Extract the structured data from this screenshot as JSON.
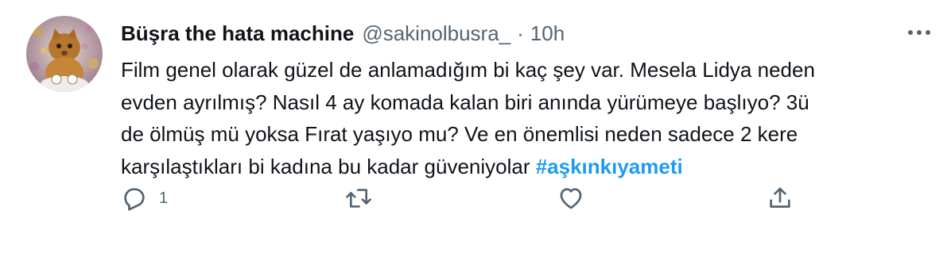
{
  "tweet": {
    "author_name": "Büşra the hata machine",
    "handle": "@sakinolbusra_",
    "separator": "·",
    "time": "10h",
    "text_lines": [
      "Film genel olarak güzel de anlamadığım bi kaç şey var. Mesela Lidya neden",
      "evden ayrılmış? Nasıl 4 ay komada kalan biri anında yürümeye başlıyo? 3ü",
      "de ölmüş mü yoksa Fırat yaşıyo mu? Ve en önemlisi neden sadece 2 kere",
      "karşılaştıkları bi kadına bu kadar güveniyolar "
    ],
    "hashtag": "#aşkınkıyameti"
  },
  "actions": {
    "reply_count": "1",
    "icons": [
      "reply-icon",
      "retweet-icon",
      "like-icon",
      "share-icon",
      "more-icon"
    ]
  },
  "colors": {
    "text": "#0f1419",
    "secondary": "#536471",
    "accent": "#1d9bf0",
    "background": "#ffffff"
  }
}
